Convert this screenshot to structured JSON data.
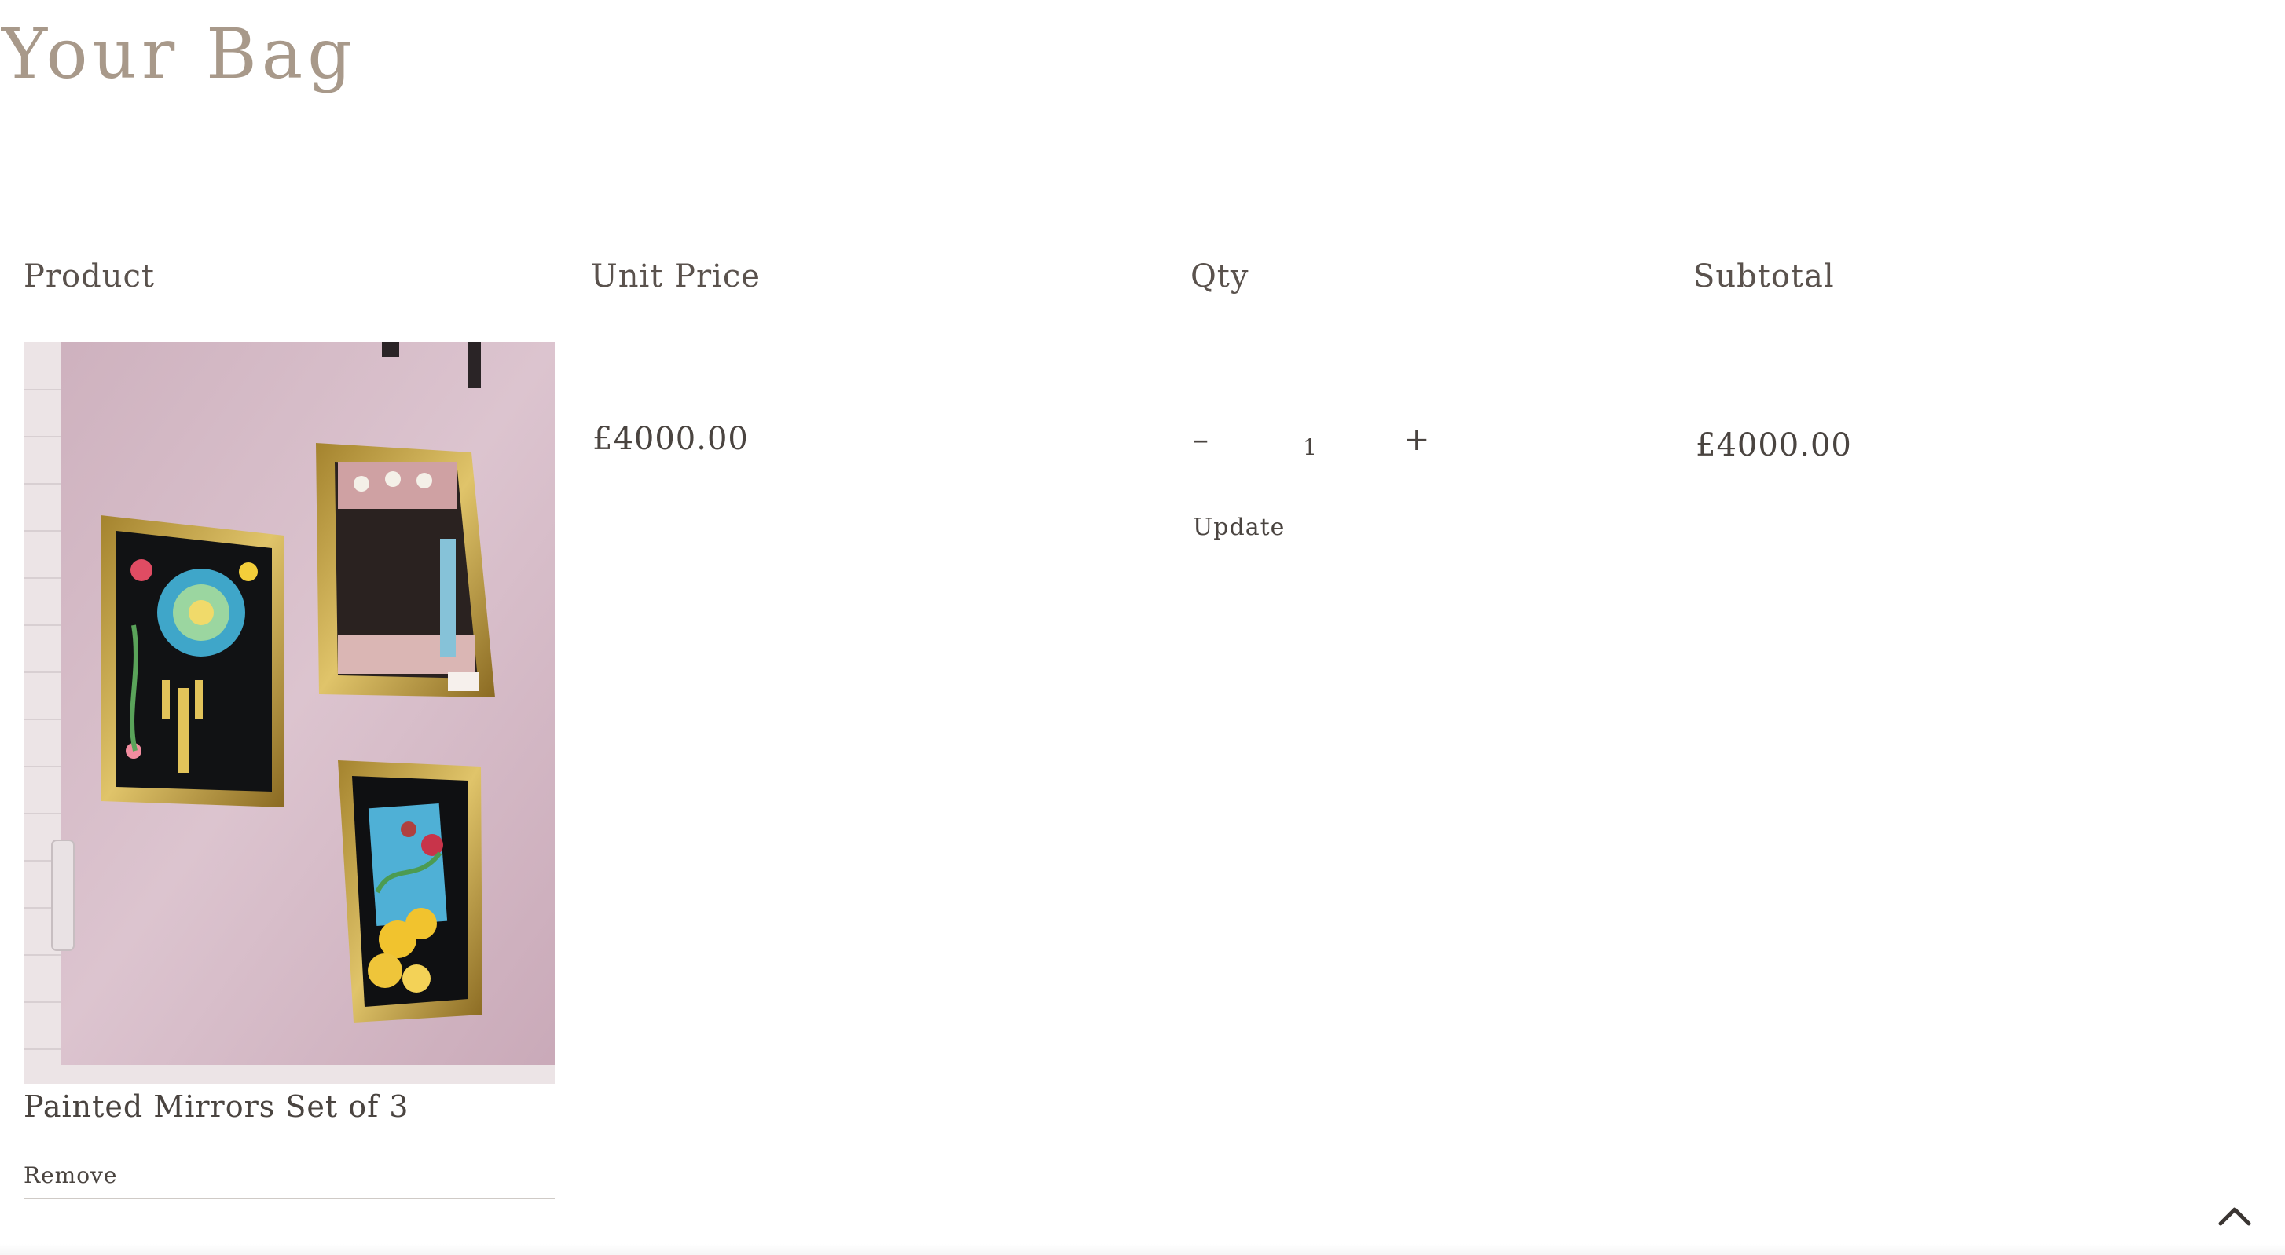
{
  "page": {
    "title": "Your Bag"
  },
  "table": {
    "headers": {
      "product": "Product",
      "unit_price": "Unit Price",
      "qty": "Qty",
      "subtotal": "Subtotal"
    }
  },
  "items": [
    {
      "name": "Painted Mirrors Set of 3",
      "image_icon": "product-photo-painted-mirrors",
      "unit_price": "£4000.00",
      "quantity": "1",
      "subtotal": "£4000.00",
      "remove_label": "Remove",
      "update_label": "Update",
      "minus_glyph": "–",
      "plus_glyph": "+"
    }
  ],
  "footer": {
    "back_to_top_icon": "chevron-up-icon"
  },
  "colors": {
    "title": "#a8998a",
    "text": "#4a4440",
    "divider": "#cfcac6",
    "background": "#ffffff"
  }
}
